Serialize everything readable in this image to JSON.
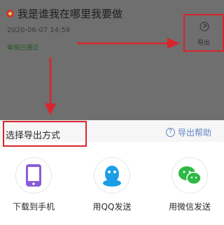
{
  "note": {
    "title": "我是谁我在哪里我要做",
    "date": "2020-06-07 14:59",
    "status": "审核已通过"
  },
  "export_button": {
    "label": "导出",
    "icon": "export-icon"
  },
  "sheet": {
    "heading": "选择导出方式",
    "help_label": "导出帮助",
    "help_icon": "question-circle-icon",
    "options": [
      {
        "label": "下载到手机",
        "icon": "phone-icon",
        "color": "#8a5cd6"
      },
      {
        "label": "用QQ发送",
        "icon": "qq-penguin-icon",
        "color": "#1a9ee6"
      },
      {
        "label": "用微信发送",
        "icon": "wechat-icon",
        "color": "#2fb845"
      }
    ]
  },
  "colors": {
    "highlight": "#d8262c",
    "overlay": "#6f6f6f",
    "link": "#5f86c6"
  }
}
